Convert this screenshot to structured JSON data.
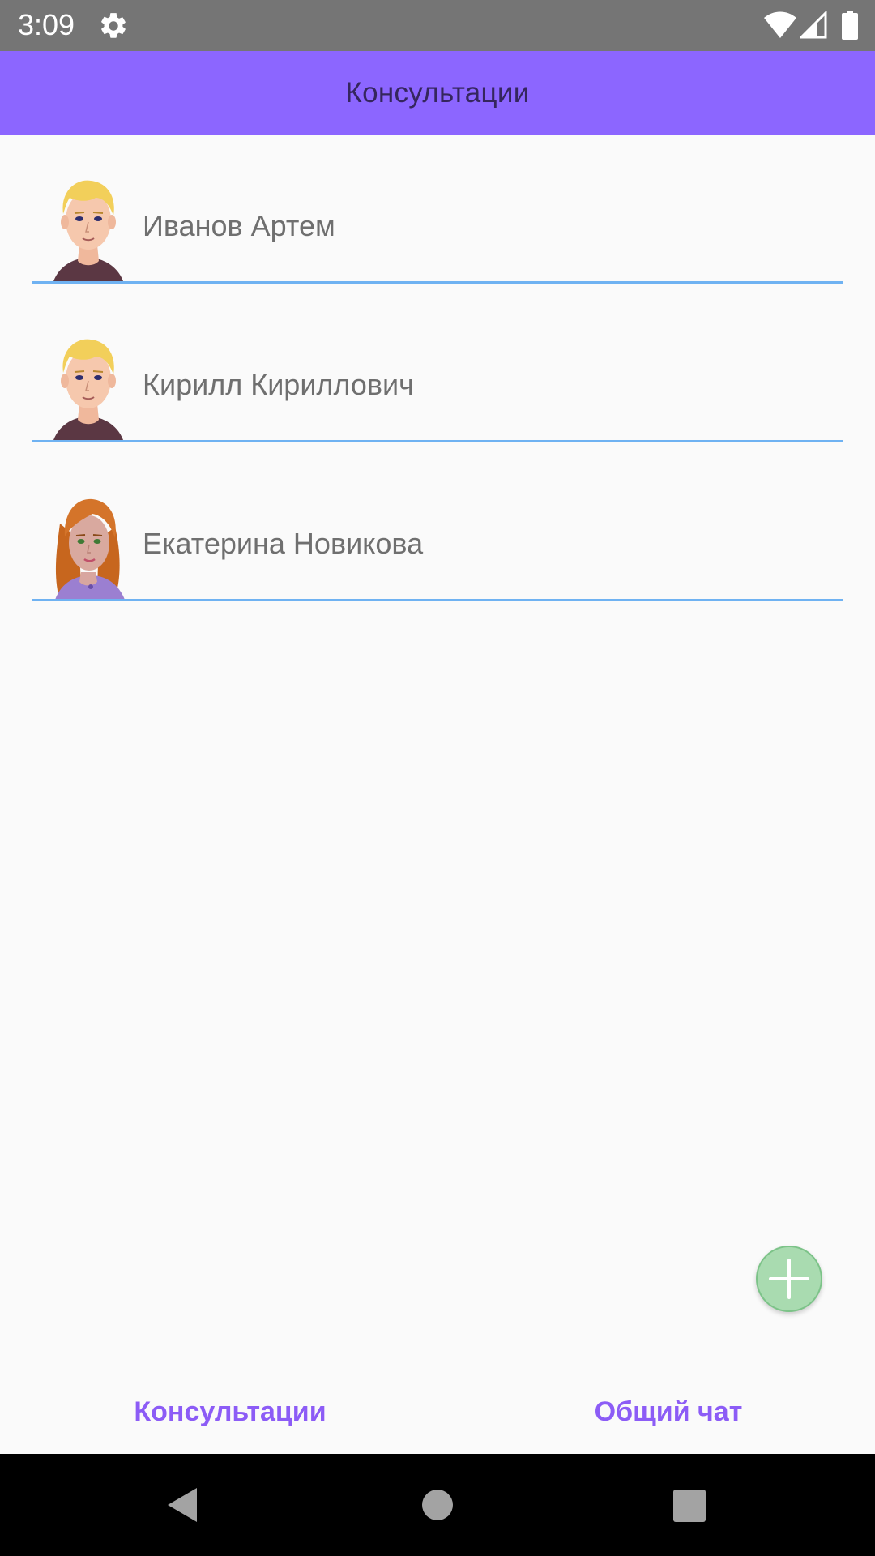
{
  "status_bar": {
    "time": "3:09",
    "icons": [
      "gear-icon",
      "wifi-icon",
      "signal-icon",
      "battery-icon"
    ]
  },
  "app_bar": {
    "title": "Консультации",
    "background": "#8c66ff"
  },
  "consultations": [
    {
      "name": "Иванов Артем",
      "avatar": "blond-man-avatar"
    },
    {
      "name": "Кирилл Кириллович",
      "avatar": "blond-man-avatar"
    },
    {
      "name": "Екатерина Новикова",
      "avatar": "red-hair-woman-avatar"
    }
  ],
  "fab": {
    "icon": "plus-icon",
    "color": "#a9dbb0"
  },
  "bottom_nav": {
    "consultations_label": "Консультации",
    "general_chat_label": "Общий чат",
    "accent": "#8c5cf6"
  },
  "system_nav": {
    "icons": [
      "back-icon",
      "home-icon",
      "recents-icon"
    ]
  }
}
